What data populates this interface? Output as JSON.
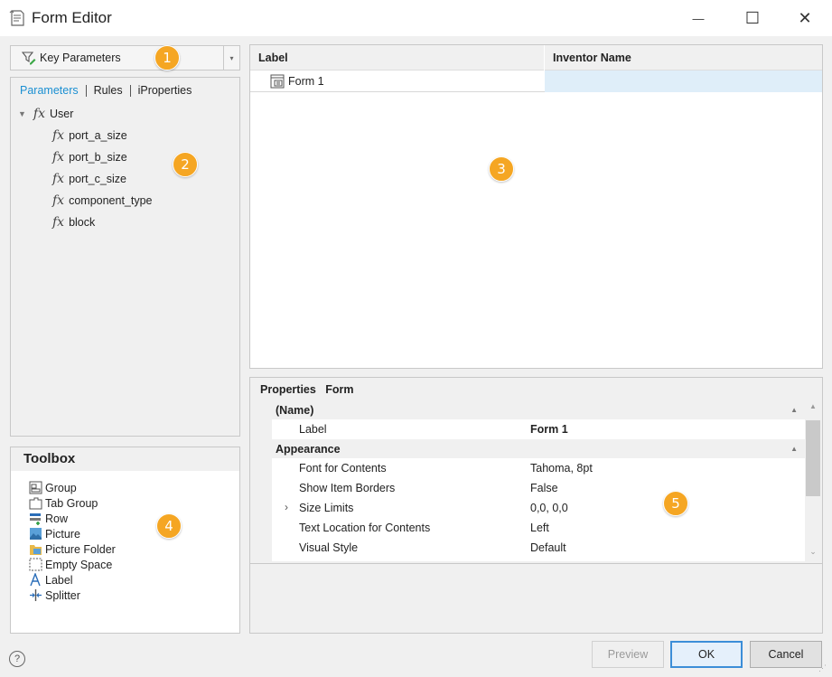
{
  "window": {
    "title": "Form Editor",
    "minimize_glyph": "—",
    "maximize_glyph": "☐",
    "close_glyph": "✕"
  },
  "key_parameters": {
    "label": "Key Parameters",
    "dropdown_glyph": "▾",
    "icon": "filter-edit-icon"
  },
  "param_tabs": [
    {
      "label": "Parameters",
      "active": true
    },
    {
      "label": "Rules",
      "active": false
    },
    {
      "label": "iProperties",
      "active": false
    }
  ],
  "param_tree": {
    "root": {
      "label": "User",
      "fx": "fx",
      "expander": "▼"
    },
    "items": [
      "port_a_size",
      "port_b_size",
      "port_c_size",
      "component_type",
      "block"
    ]
  },
  "toolbox": {
    "title": "Toolbox",
    "items": [
      {
        "label": "Group",
        "icon": "group-icon"
      },
      {
        "label": "Tab Group",
        "icon": "tab-group-icon"
      },
      {
        "label": "Row",
        "icon": "row-icon"
      },
      {
        "label": "Picture",
        "icon": "picture-icon"
      },
      {
        "label": "Picture Folder",
        "icon": "picture-folder-icon"
      },
      {
        "label": "Empty Space",
        "icon": "empty-space-icon"
      },
      {
        "label": "Label",
        "icon": "label-icon"
      },
      {
        "label": "Splitter",
        "icon": "splitter-icon"
      }
    ]
  },
  "grid": {
    "columns": [
      "Label",
      "Inventor Name"
    ],
    "rows": [
      {
        "label": "Form 1",
        "inventor_name": ""
      }
    ]
  },
  "properties": {
    "heading": "Properties",
    "object": "Form",
    "categories": [
      {
        "name": "(Name)",
        "rows": [
          {
            "name": "Label",
            "value": "Form 1",
            "bold": true
          }
        ]
      },
      {
        "name": "Appearance",
        "rows": [
          {
            "name": "Font for Contents",
            "value": "Tahoma, 8pt"
          },
          {
            "name": "Show Item Borders",
            "value": "False"
          },
          {
            "name": "Size Limits",
            "value": "0,0, 0,0",
            "expandable": true
          },
          {
            "name": "Text Location for Contents",
            "value": "Left"
          },
          {
            "name": "Visual Style",
            "value": "Default"
          }
        ]
      }
    ],
    "collapse_glyph": "▲",
    "expand_glyph": "›"
  },
  "footer": {
    "preview": "Preview",
    "ok": "OK",
    "cancel": "Cancel",
    "help_glyph": "?",
    "grip_glyph": "⋰"
  },
  "callouts": [
    "1",
    "2",
    "3",
    "4",
    "5"
  ],
  "colors": {
    "accent": "#1a8fd2",
    "callout": "#f5a623",
    "selection": "#dfeef9"
  }
}
